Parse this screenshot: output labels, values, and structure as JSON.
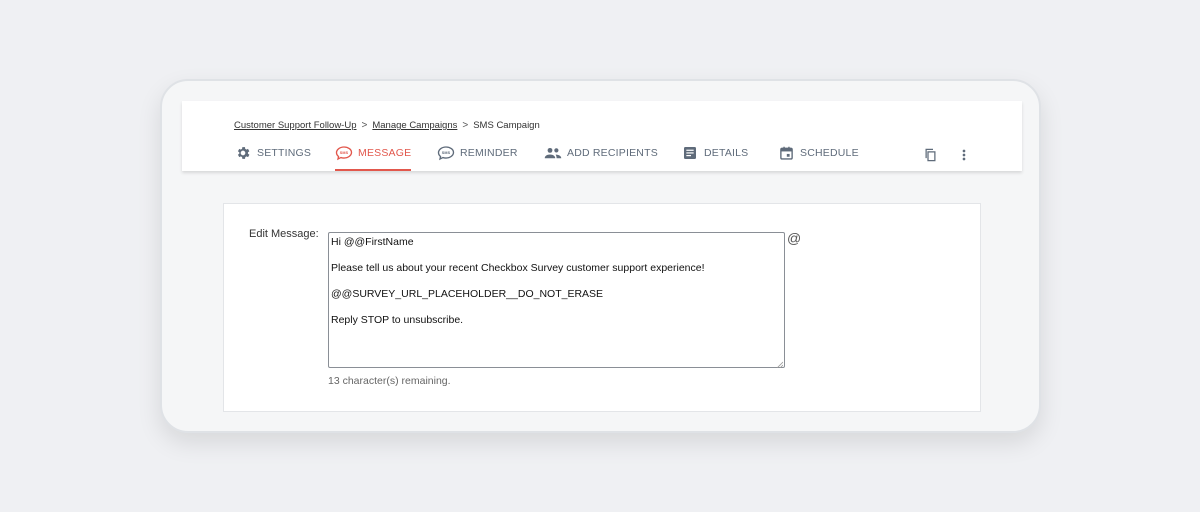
{
  "breadcrumb": {
    "items": [
      "Customer Support Follow-Up",
      "Manage Campaigns",
      "SMS Campaign"
    ],
    "separator": ">"
  },
  "tabs": [
    {
      "label": "SETTINGS",
      "icon": "gear-icon",
      "active": false
    },
    {
      "label": "MESSAGE",
      "icon": "sms-bubble-icon",
      "active": true
    },
    {
      "label": "REMINDER",
      "icon": "sms-bubble-icon",
      "active": false
    },
    {
      "label": "ADD RECIPIENTS",
      "icon": "people-icon",
      "active": false
    },
    {
      "label": "DETAILS",
      "icon": "list-details-icon",
      "active": false
    },
    {
      "label": "SCHEDULE",
      "icon": "calendar-icon",
      "active": false
    }
  ],
  "toolbar": {
    "copy_icon": "copy-icon",
    "more_icon": "more-vertical-icon"
  },
  "editor": {
    "label": "Edit Message:",
    "lines": [
      "Hi @@FirstName",
      "Please tell us about your recent Checkbox Survey customer support experience!",
      "@@SURVEY_URL_PLACEHOLDER__DO_NOT_ERASE",
      "Reply STOP to unsubscribe."
    ],
    "insert_symbol": "@",
    "remaining_text": "13 character(s) remaining."
  },
  "colors": {
    "accent": "#e2574c",
    "tab_text": "#5f6b7a",
    "background": "#eff0f3"
  }
}
